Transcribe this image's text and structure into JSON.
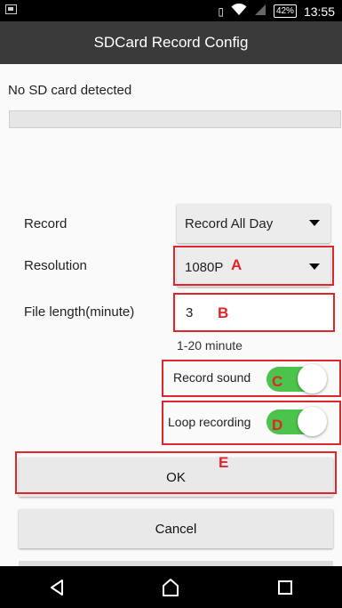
{
  "status_bar": {
    "battery": "42%",
    "time": "13:55",
    "icons": [
      "sim-icon",
      "vibrate-icon",
      "wifi-icon",
      "signal-icon",
      "battery-icon"
    ]
  },
  "app": {
    "title": "SDCard Record Config"
  },
  "sd_status": {
    "message": "No SD card detected",
    "progress": 0
  },
  "form": {
    "record": {
      "label": "Record",
      "value": "Record All Day"
    },
    "resolution": {
      "label": "Resolution",
      "value": "1080P"
    },
    "file_length": {
      "label": "File length(minute)",
      "value": "3",
      "hint": "1-20 minute"
    },
    "record_sound": {
      "label": "Record sound",
      "on": true
    },
    "loop_recording": {
      "label": "Loop recording",
      "on": true
    }
  },
  "buttons": {
    "ok": "OK",
    "cancel": "Cancel"
  },
  "annotations": {
    "a": "A",
    "b": "B",
    "c": "C",
    "d": "D",
    "e": "E",
    "color": "#e0252b"
  },
  "nav": {
    "icons": [
      "back-icon",
      "home-icon",
      "recents-icon"
    ]
  },
  "colors": {
    "title_bar": "#3a3a3a",
    "toggle_on": "#4cc34c"
  }
}
